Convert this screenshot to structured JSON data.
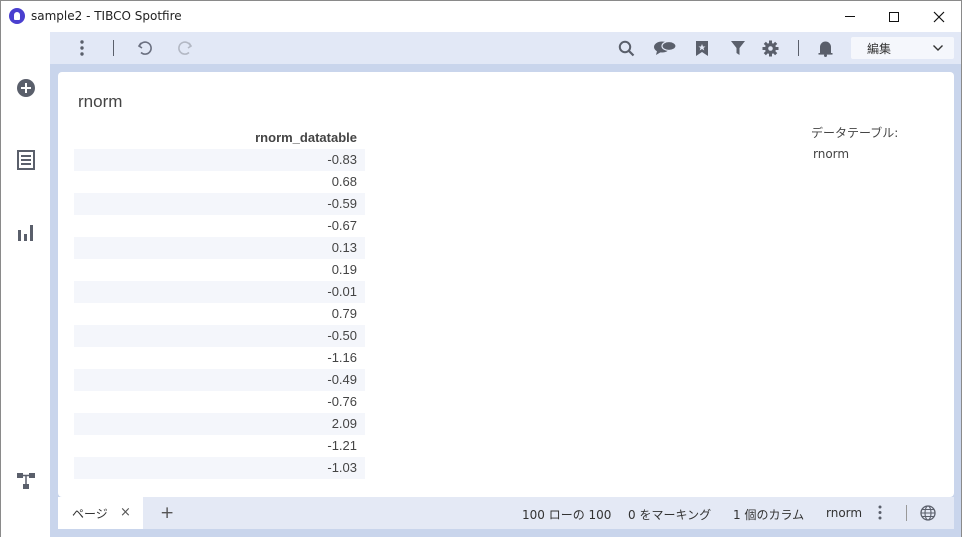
{
  "window": {
    "title": "sample2 - TIBCO Spotfire"
  },
  "toolbar": {
    "mode_label": "編集"
  },
  "visualization": {
    "title": "rnorm",
    "column_header": "rnorm_datatable",
    "rows": [
      "-0.83",
      "0.68",
      "-0.59",
      "-0.67",
      "0.13",
      "0.19",
      "-0.01",
      "0.79",
      "-0.50",
      "-1.16",
      "-0.49",
      "-0.76",
      "2.09",
      "-1.21",
      "-1.03"
    ]
  },
  "legend": {
    "title": "データテーブル:",
    "value": "rnorm"
  },
  "pagebar": {
    "tab_label": "ページ",
    "close_glyph": "×",
    "add_glyph": "+"
  },
  "statusbar": {
    "rows": "100 ローの 100",
    "marked": "0 をマーキング",
    "columns": "1 個のカラム",
    "table": "rnorm"
  },
  "colors": {
    "accent": "#4a3fcf",
    "canvas_bg": "#c9d5ec",
    "toolbar_bg": "#e2e8f6"
  },
  "icons": [
    "app-logo-icon",
    "kebab-menu-icon",
    "undo-icon",
    "redo-icon",
    "search-icon",
    "comments-icon",
    "bookmark-icon",
    "filter-icon",
    "gear-icon",
    "bell-icon",
    "chevron-down-icon",
    "add-circle-icon",
    "data-table-icon",
    "bar-chart-icon",
    "data-canvas-icon",
    "globe-icon"
  ]
}
